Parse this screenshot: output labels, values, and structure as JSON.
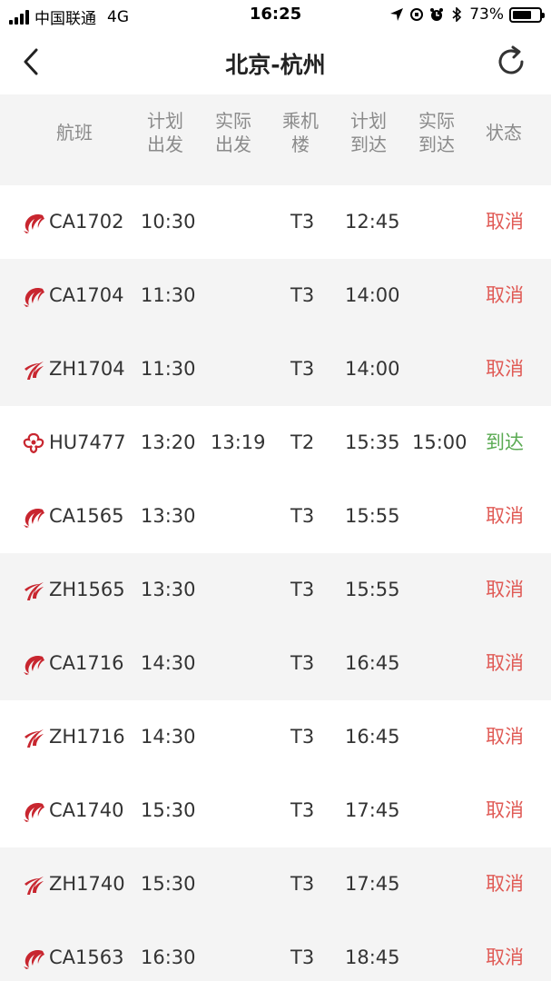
{
  "status_bar": {
    "carrier": "中国联通",
    "network": "4G",
    "time": "16:25",
    "battery": "73%",
    "battery_level": 0.73
  },
  "nav": {
    "title": "北京-杭州",
    "back_icon": "chevron-left-icon",
    "refresh_icon": "refresh-icon"
  },
  "table": {
    "headers": {
      "flight": "航班",
      "sched_dep": [
        "计划",
        "出发"
      ],
      "actual_dep": [
        "实际",
        "出发"
      ],
      "terminal": [
        "乘机",
        "楼"
      ],
      "sched_arr": [
        "计划",
        "到达"
      ],
      "actual_arr": [
        "实际",
        "到达"
      ],
      "status": "状态"
    },
    "colors": {
      "cancel": "#e05a55",
      "arrived": "#5aaa52",
      "logo": "#c8262f"
    },
    "rows": [
      {
        "airline": "air-china",
        "flight": "CA1702",
        "sched_dep": "10:30",
        "actual_dep": "",
        "terminal": "T3",
        "sched_arr": "12:45",
        "actual_arr": "",
        "status": "取消",
        "status_kind": "cancel"
      },
      {
        "airline": "air-china",
        "flight": "CA1704",
        "sched_dep": "11:30",
        "actual_dep": "",
        "terminal": "T3",
        "sched_arr": "14:00",
        "actual_arr": "",
        "status": "取消",
        "status_kind": "cancel"
      },
      {
        "airline": "shenzhen-airlines",
        "flight": "ZH1704",
        "sched_dep": "11:30",
        "actual_dep": "",
        "terminal": "T3",
        "sched_arr": "14:00",
        "actual_arr": "",
        "status": "取消",
        "status_kind": "cancel"
      },
      {
        "airline": "hainan-airlines",
        "flight": "HU7477",
        "sched_dep": "13:20",
        "actual_dep": "13:19",
        "terminal": "T2",
        "sched_arr": "15:35",
        "actual_arr": "15:00",
        "status": "到达",
        "status_kind": "arrived"
      },
      {
        "airline": "air-china",
        "flight": "CA1565",
        "sched_dep": "13:30",
        "actual_dep": "",
        "terminal": "T3",
        "sched_arr": "15:55",
        "actual_arr": "",
        "status": "取消",
        "status_kind": "cancel"
      },
      {
        "airline": "shenzhen-airlines",
        "flight": "ZH1565",
        "sched_dep": "13:30",
        "actual_dep": "",
        "terminal": "T3",
        "sched_arr": "15:55",
        "actual_arr": "",
        "status": "取消",
        "status_kind": "cancel"
      },
      {
        "airline": "air-china",
        "flight": "CA1716",
        "sched_dep": "14:30",
        "actual_dep": "",
        "terminal": "T3",
        "sched_arr": "16:45",
        "actual_arr": "",
        "status": "取消",
        "status_kind": "cancel"
      },
      {
        "airline": "shenzhen-airlines",
        "flight": "ZH1716",
        "sched_dep": "14:30",
        "actual_dep": "",
        "terminal": "T3",
        "sched_arr": "16:45",
        "actual_arr": "",
        "status": "取消",
        "status_kind": "cancel"
      },
      {
        "airline": "air-china",
        "flight": "CA1740",
        "sched_dep": "15:30",
        "actual_dep": "",
        "terminal": "T3",
        "sched_arr": "17:45",
        "actual_arr": "",
        "status": "取消",
        "status_kind": "cancel"
      },
      {
        "airline": "shenzhen-airlines",
        "flight": "ZH1740",
        "sched_dep": "15:30",
        "actual_dep": "",
        "terminal": "T3",
        "sched_arr": "17:45",
        "actual_arr": "",
        "status": "取消",
        "status_kind": "cancel"
      },
      {
        "airline": "air-china",
        "flight": "CA1563",
        "sched_dep": "16:30",
        "actual_dep": "",
        "terminal": "T3",
        "sched_arr": "18:45",
        "actual_arr": "",
        "status": "取消",
        "status_kind": "cancel"
      }
    ]
  }
}
